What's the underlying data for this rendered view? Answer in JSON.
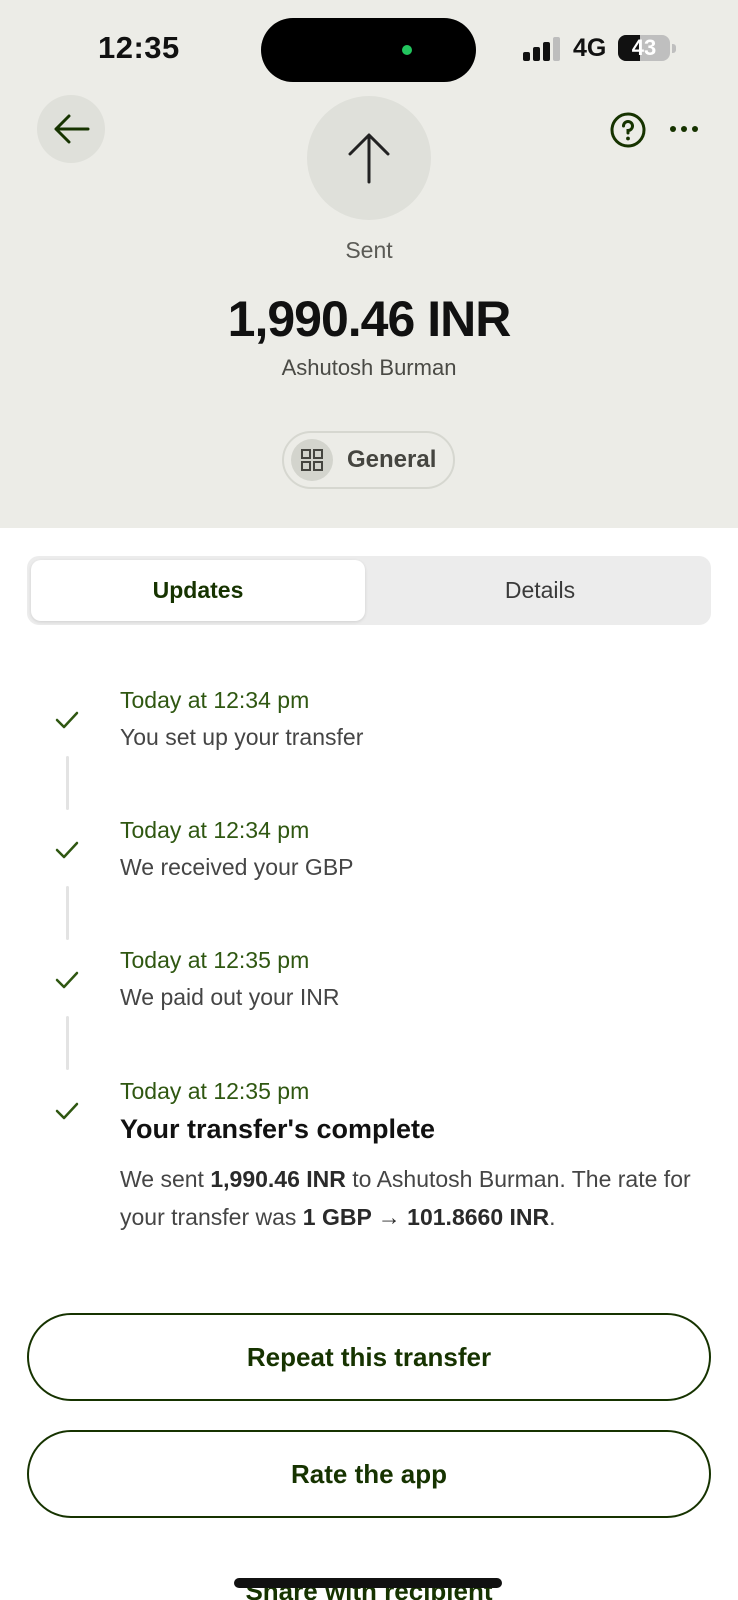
{
  "status_bar": {
    "time": "12:35",
    "network": "4G",
    "battery": "43",
    "battery_level": 0.43
  },
  "header": {
    "status_label": "Sent",
    "amount": "1,990.46 INR",
    "recipient": "Ashutosh Burman",
    "category": "General",
    "icons": [
      "back-arrow-icon",
      "up-arrow-icon",
      "help-icon",
      "more-icon",
      "grid-icon"
    ]
  },
  "tabs": [
    {
      "label": "Updates",
      "active": true
    },
    {
      "label": "Details",
      "active": false
    }
  ],
  "timeline": [
    {
      "time": "Today at 12:34 pm",
      "text": "You set up your transfer"
    },
    {
      "time": "Today at 12:34 pm",
      "text": "We received your GBP"
    },
    {
      "time": "Today at 12:35 pm",
      "text": "We paid out your INR"
    },
    {
      "time": "Today at 12:35 pm",
      "title": "Your transfer's complete"
    }
  ],
  "completion": {
    "p1": "We sent ",
    "amount": "1,990.46 INR",
    "p2": " to Ashutosh Burman. The rate for your transfer was ",
    "rate": "1 GBP → 101.8660 INR",
    "p3": "."
  },
  "buttons": {
    "repeat": "Repeat this transfer",
    "rate": "Rate the app",
    "share": "Share with recipient"
  },
  "colors": {
    "brand_green": "#163300",
    "time_green": "#2f5711",
    "header_bg": "#ecece7"
  }
}
